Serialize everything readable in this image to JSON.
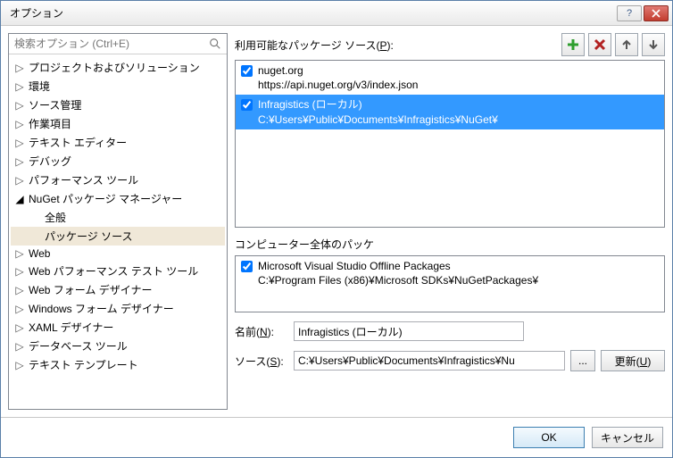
{
  "title": "オプション",
  "search_placeholder": "検索オプション (Ctrl+E)",
  "tree": [
    {
      "label": "プロジェクトおよびソリューション",
      "type": "node"
    },
    {
      "label": "環境",
      "type": "node"
    },
    {
      "label": "ソース管理",
      "type": "node"
    },
    {
      "label": "作業項目",
      "type": "node"
    },
    {
      "label": "テキスト エディター",
      "type": "node"
    },
    {
      "label": "デバッグ",
      "type": "node"
    },
    {
      "label": "パフォーマンス ツール",
      "type": "node"
    },
    {
      "label": "NuGet パッケージ マネージャー",
      "type": "expanded"
    },
    {
      "label": "全般",
      "type": "child"
    },
    {
      "label": "パッケージ ソース",
      "type": "child",
      "selected": true
    },
    {
      "label": "Web",
      "type": "node"
    },
    {
      "label": "Web パフォーマンス テスト ツール",
      "type": "node"
    },
    {
      "label": "Web フォーム デザイナー",
      "type": "node"
    },
    {
      "label": "Windows フォーム デザイナー",
      "type": "node"
    },
    {
      "label": "XAML デザイナー",
      "type": "node"
    },
    {
      "label": "データベース ツール",
      "type": "node"
    },
    {
      "label": "テキスト テンプレート",
      "type": "node"
    }
  ],
  "right": {
    "available_label_prefix": "利用可能なパッケージ ソース(",
    "available_label_key": "P",
    "available_label_suffix": "):",
    "sources": [
      {
        "name": "nuget.org",
        "path": "https://api.nuget.org/v3/index.json",
        "checked": true,
        "selected": false
      },
      {
        "name": "Infragistics (ローカル)",
        "path": "C:¥Users¥Public¥Documents¥Infragistics¥NuGet¥",
        "checked": true,
        "selected": true
      }
    ],
    "machine_label": "コンピューター全体のパッケ",
    "machine_sources": [
      {
        "name": "Microsoft Visual Studio Offline Packages",
        "path": "C:¥Program Files (x86)¥Microsoft SDKs¥NuGetPackages¥",
        "checked": true
      }
    ],
    "name_label_prefix": "名前(",
    "name_label_key": "N",
    "name_label_suffix": "):",
    "name_value": "Infragistics (ローカル)",
    "source_label_prefix": "ソース(",
    "source_label_key": "S",
    "source_label_suffix": "):",
    "source_value": "C:¥Users¥Public¥Documents¥Infragistics¥Nu",
    "browse_label": "...",
    "update_label_prefix": "更新(",
    "update_label_key": "U",
    "update_label_suffix": ")"
  },
  "buttons": {
    "ok": "OK",
    "cancel": "キャンセル"
  },
  "icons": {
    "plus_color": "#2e9e2e",
    "x_color": "#b22222",
    "arrow_color": "#555555"
  }
}
